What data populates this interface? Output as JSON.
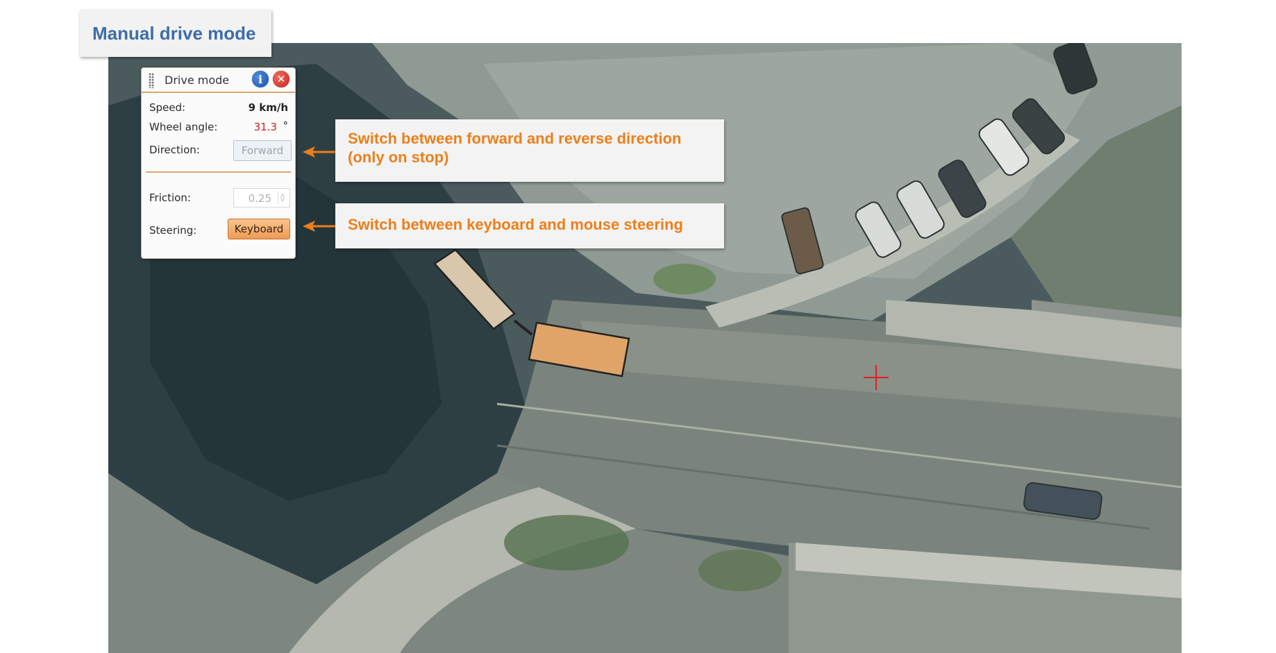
{
  "page_title": "Manual drive mode",
  "panel": {
    "title": "Drive mode",
    "info_glyph": "i",
    "close_glyph": "✕",
    "speed_label": "Speed:",
    "speed_value": "9 km/h",
    "wheel_angle_label": "Wheel angle:",
    "wheel_angle_value": "31.3",
    "wheel_angle_unit": "°",
    "direction_label": "Direction:",
    "direction_value": "Forward",
    "friction_label": "Friction:",
    "friction_value": "0.25",
    "friction_spin_glyph": "◊",
    "steering_label": "Steering:",
    "steering_value": "Keyboard"
  },
  "callouts": {
    "direction_line1": "Switch between forward and reverse direction",
    "direction_line2": "(only on stop)",
    "steering": "Switch between keyboard and mouse steering"
  },
  "colors": {
    "title_blue": "#3d6ea8",
    "callout_orange": "#ee7e1a",
    "angle_red": "#d42020",
    "vehicle_tan": "#e0a469",
    "trailer_beige": "#d8c6ad",
    "crosshair_red": "#e02020"
  },
  "icons": [
    "drag-handle-icon",
    "info-icon",
    "close-icon",
    "spinner-icon",
    "arrow-left-icon",
    "crosshair-icon"
  ]
}
